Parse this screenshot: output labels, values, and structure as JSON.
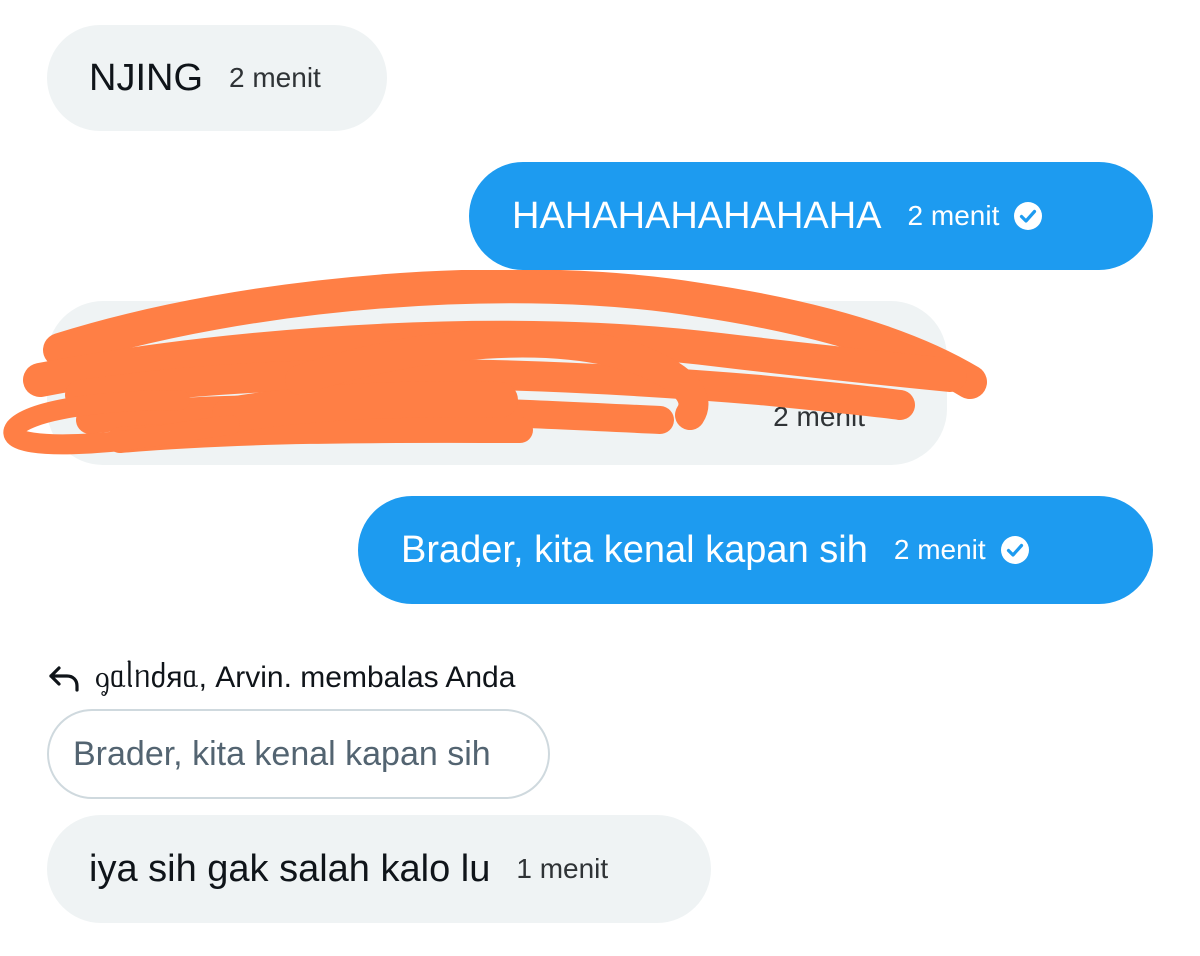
{
  "messages": [
    {
      "direction": "incoming",
      "text": "NJING",
      "time": "2 menit"
    },
    {
      "direction": "outgoing",
      "text": "HAHAHAHAHAHAHA",
      "time": "2 menit",
      "status_icon": "check-circle-icon"
    },
    {
      "direction": "incoming",
      "text": "",
      "time": "2 menit",
      "redacted": true
    },
    {
      "direction": "outgoing",
      "text": "Brader, kita kenal kapan sih",
      "time": "2 menit",
      "status_icon": "check-circle-icon"
    },
    {
      "direction": "incoming",
      "text": "iya sih gak salah kalo lu",
      "time": "1 menit"
    }
  ],
  "reply_context": {
    "icon": "reply-arrow-icon",
    "text": "ᧁᥲᥣᥒძяᥲ, Arvin. membalas Anda",
    "quoted_text": "Brader, kita kenal kapan sih"
  },
  "colors": {
    "outgoing_bubble": "#1d9bf0",
    "incoming_bubble": "#eff3f4",
    "redaction": "#ff7f45",
    "quoted_border": "#cfd9de"
  }
}
